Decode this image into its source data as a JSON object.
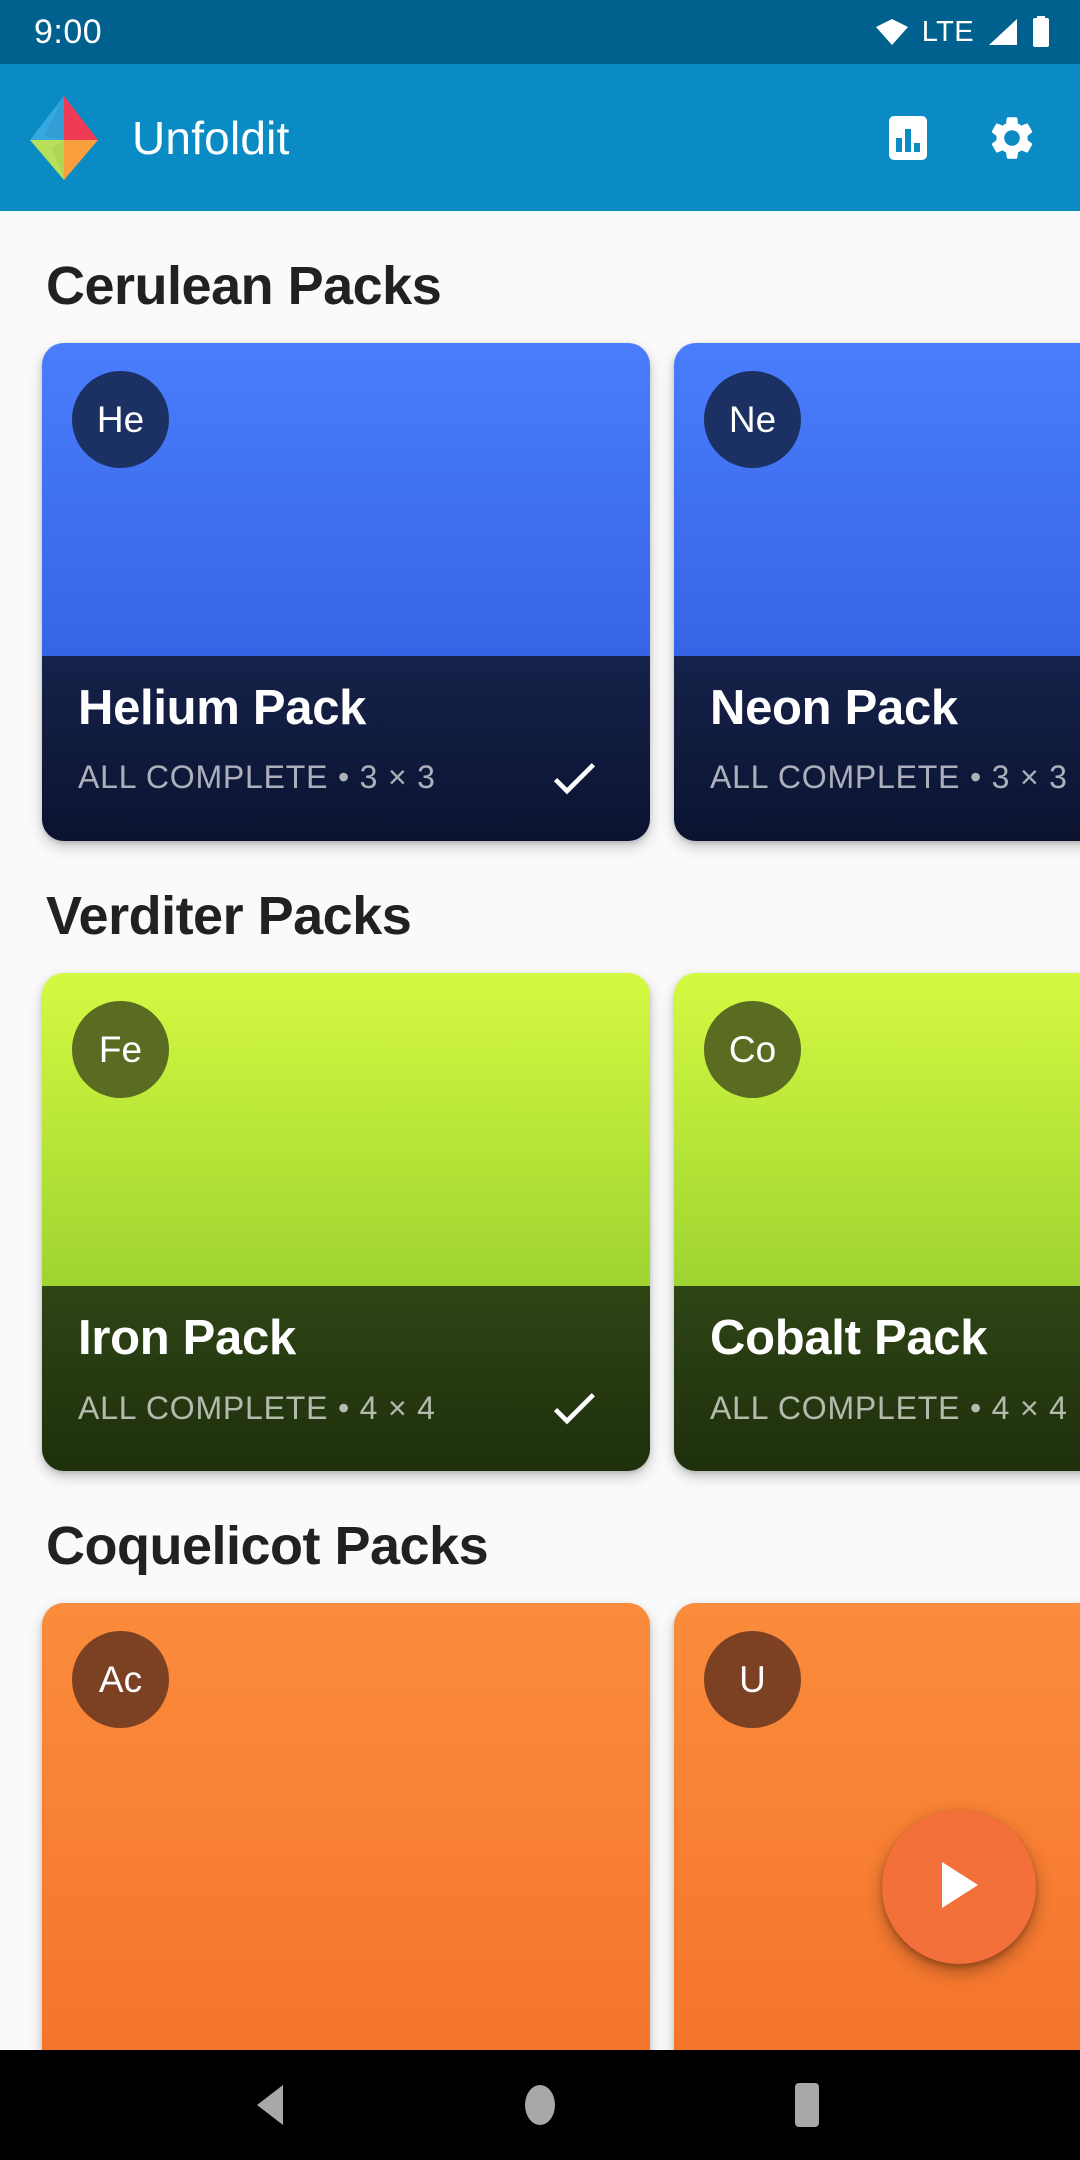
{
  "status_bar": {
    "time": "9:00",
    "network_label": "LTE",
    "icons": [
      "wifi-icon",
      "signal-icon",
      "battery-icon"
    ],
    "background": "#00618f"
  },
  "app_bar": {
    "title": "Unfoldit",
    "logo_name": "unfoldit-logo",
    "background": "#0b8bc4",
    "actions": [
      {
        "name": "stats-icon",
        "label": "Stats"
      },
      {
        "name": "settings-gear-icon",
        "label": "Settings"
      }
    ],
    "logo_colors": {
      "top_left": "#35a8e0",
      "top_right": "#ef3b55",
      "bottom_left": "#b9e05a",
      "bottom_right": "#f9a03c"
    }
  },
  "sections": [
    {
      "title": "Cerulean Packs",
      "theme": "t-cerulean",
      "cards": [
        {
          "badge": "He",
          "name": "Helium Pack",
          "subtitle": "ALL COMPLETE • 3 × 3",
          "complete": true
        },
        {
          "badge": "Ne",
          "name": "Neon Pack",
          "subtitle": "ALL COMPLETE • 3 × 3",
          "complete": true
        }
      ]
    },
    {
      "title": "Verditer Packs",
      "theme": "t-verditer",
      "cards": [
        {
          "badge": "Fe",
          "name": "Iron Pack",
          "subtitle": "ALL COMPLETE • 4 × 4",
          "complete": true
        },
        {
          "badge": "Co",
          "name": "Cobalt Pack",
          "subtitle": "ALL COMPLETE • 4 × 4",
          "complete": true
        }
      ]
    },
    {
      "title": "Coquelicot Packs",
      "theme": "t-coquelicot",
      "cards": [
        {
          "badge": "Ac",
          "name": "",
          "subtitle": "",
          "complete": false
        },
        {
          "badge": "U",
          "name": "",
          "subtitle": "",
          "complete": false
        }
      ]
    }
  ],
  "fab": {
    "name": "play-fab",
    "icon": "play-icon",
    "color": "#f4703a"
  },
  "nav_bar": {
    "background": "#000000",
    "buttons": [
      {
        "name": "nav-back-button",
        "icon": "triangle-left-icon"
      },
      {
        "name": "nav-home-button",
        "icon": "circle-icon"
      },
      {
        "name": "nav-recents-button",
        "icon": "square-icon"
      }
    ]
  }
}
